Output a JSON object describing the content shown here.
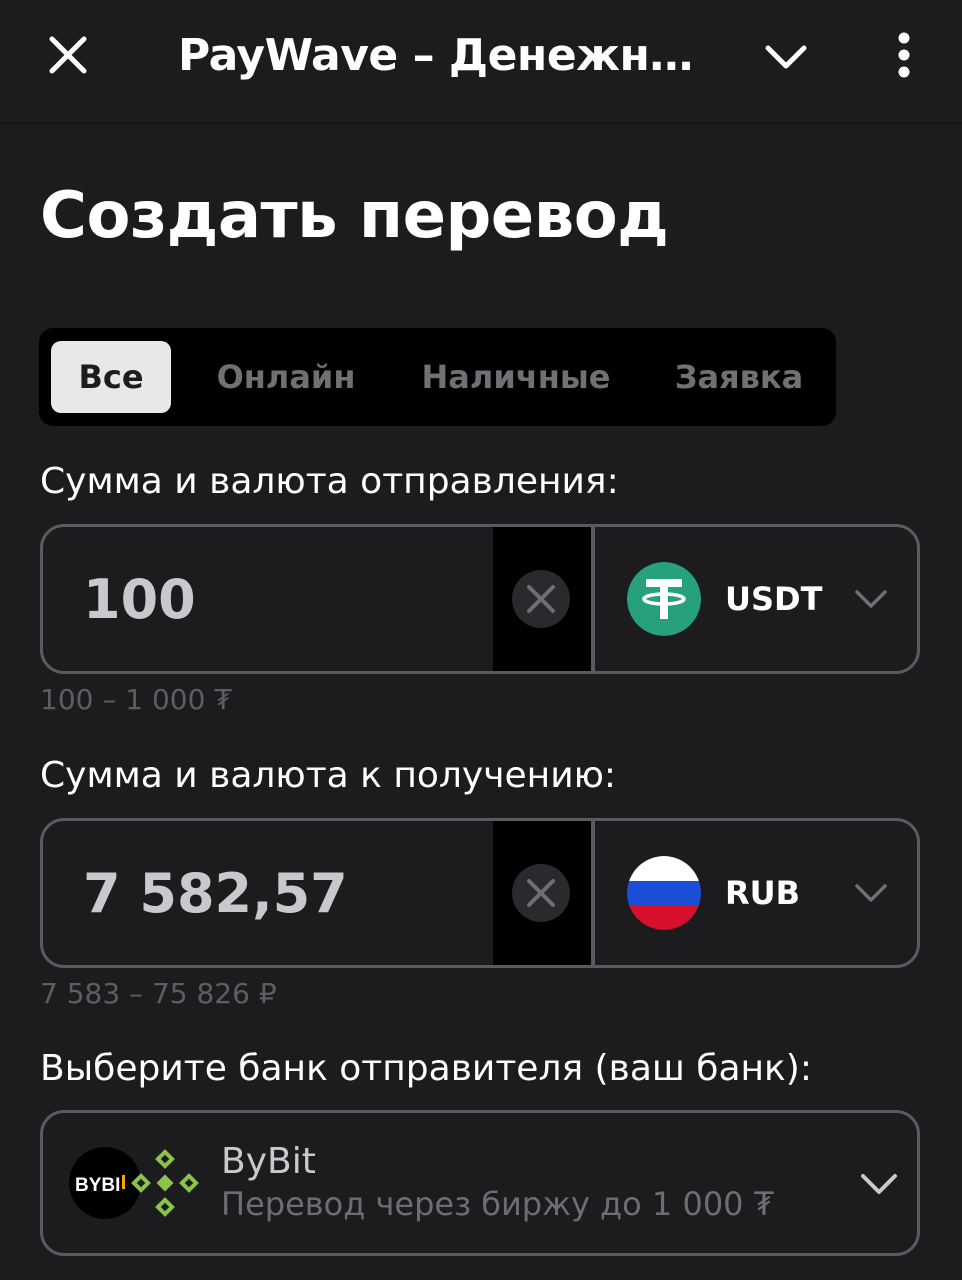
{
  "header": {
    "title": "PayWave – Денежн…",
    "close_icon": "close-icon",
    "collapse_icon": "chevron-down-icon",
    "more_icon": "more-vertical-icon"
  },
  "page": {
    "title": "Создать перевод"
  },
  "tabs": [
    {
      "label": "Все",
      "active": true
    },
    {
      "label": "Онлайн",
      "active": false
    },
    {
      "label": "Наличные",
      "active": false
    },
    {
      "label": "Заявка",
      "active": false
    }
  ],
  "send": {
    "label": "Сумма и валюта отправления:",
    "amount": "100",
    "currency": "USDT",
    "currency_icon": "tether-icon",
    "hint": "100 – 1 000 ₮"
  },
  "receive": {
    "label": "Сумма и валюта к получению:",
    "amount": "7 582,57",
    "currency": "RUB",
    "currency_icon": "russia-flag-icon",
    "hint": "7 583 – 75 826 ₽"
  },
  "bank": {
    "label": "Выберите банк отправителя (ваш банк):",
    "name": "ByBit",
    "description": "Перевод через биржу до 1 000 ₮",
    "logo_text": "BYBI"
  },
  "colors": {
    "background": "#1c1c1e",
    "tether_green": "#26a17b",
    "binance_green": "#8bc34a",
    "tab_active_bg": "#e8e8ea"
  }
}
